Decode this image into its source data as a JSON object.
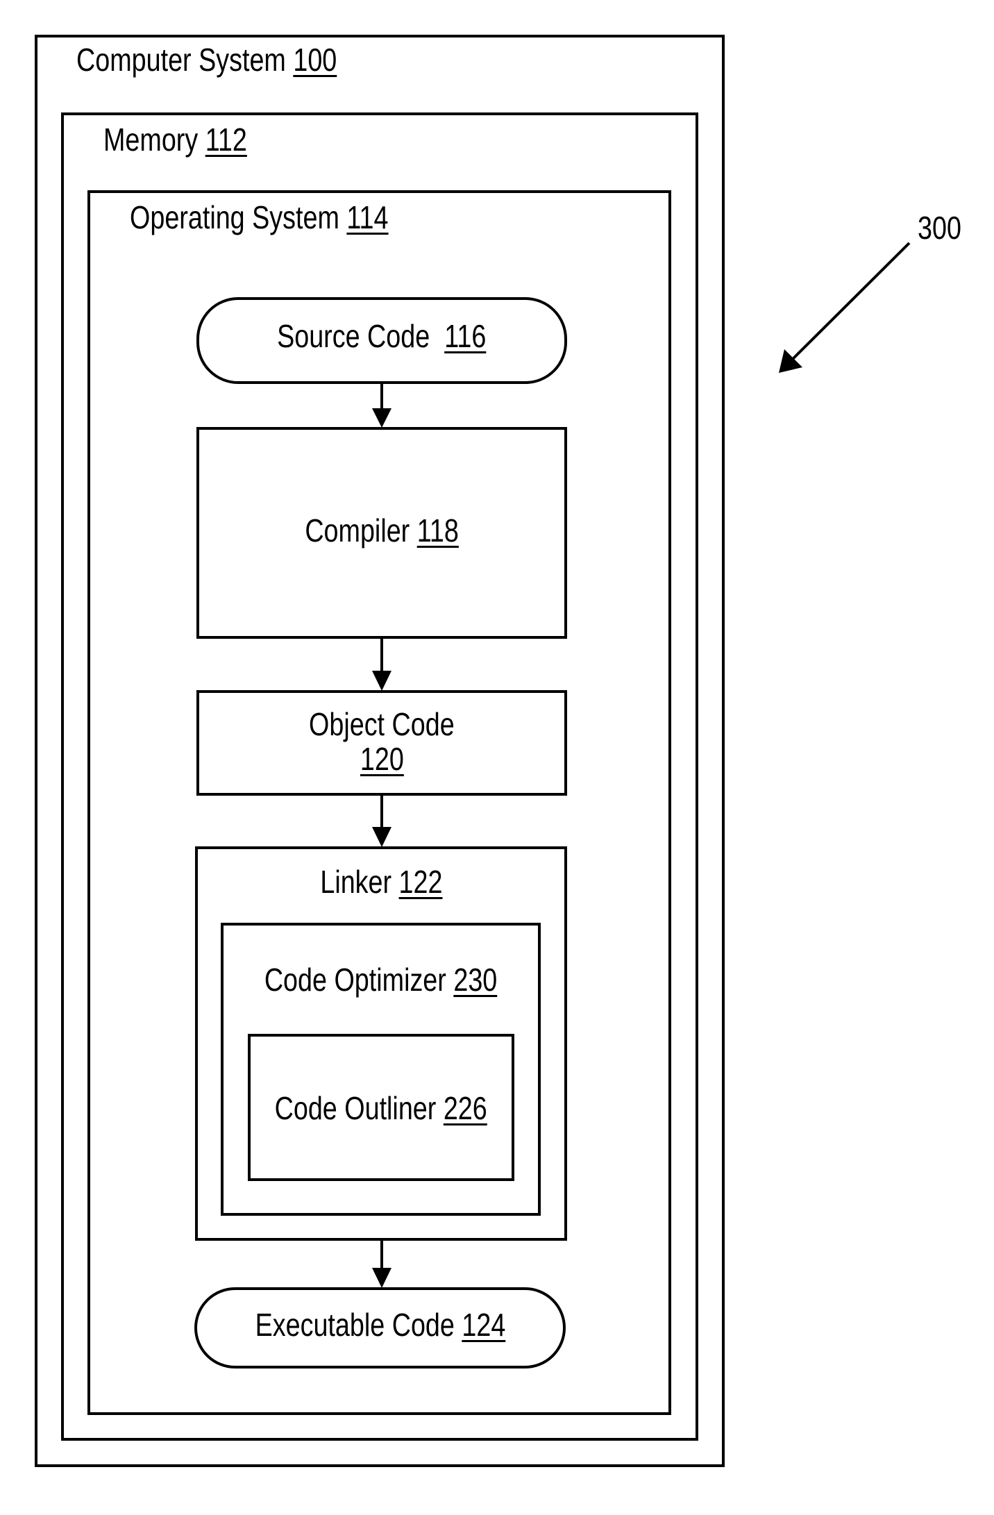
{
  "figure_number": "300",
  "computer_system": {
    "label": "Computer System",
    "ref": "100"
  },
  "memory": {
    "label": "Memory",
    "ref": "112"
  },
  "operating_system": {
    "label": "Operating System",
    "ref": "114"
  },
  "source_code": {
    "label": "Source Code",
    "ref": "116"
  },
  "compiler": {
    "label": "Compiler",
    "ref": "118"
  },
  "object_code": {
    "label": "Object Code",
    "ref": "120"
  },
  "linker": {
    "label": "Linker",
    "ref": "122"
  },
  "code_optimizer": {
    "label": "Code Optimizer",
    "ref": "230"
  },
  "code_outliner": {
    "label": "Code Outliner",
    "ref": "226"
  },
  "executable_code": {
    "label": "Executable Code",
    "ref": "124"
  },
  "flow": [
    "Source Code 116",
    "Compiler 118",
    "Object Code 120",
    "Linker 122",
    "Executable Code 124"
  ]
}
